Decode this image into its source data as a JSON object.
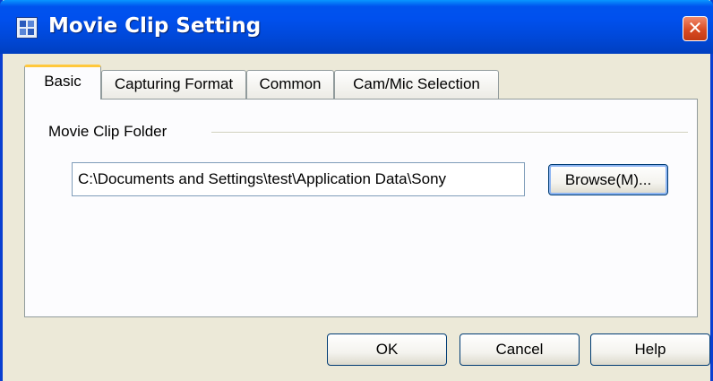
{
  "window": {
    "title": "Movie Clip Setting",
    "close_label": "✕",
    "accent_color": "#0053ee"
  },
  "tabs": [
    {
      "label": "Basic",
      "active": true
    },
    {
      "label": "Capturing Format",
      "active": false
    },
    {
      "label": "Common",
      "active": false
    },
    {
      "label": "Cam/Mic Selection",
      "active": false
    }
  ],
  "basic": {
    "group_label": "Movie Clip Folder",
    "folder_path": "C:\\Documents and Settings\\test\\Application Data\\Sony",
    "browse_label": "Browse(M)..."
  },
  "footer": {
    "ok_label": "OK",
    "cancel_label": "Cancel",
    "help_label": "Help"
  },
  "icons": {
    "app_icon": "app-icon",
    "close_icon": "close-icon"
  }
}
